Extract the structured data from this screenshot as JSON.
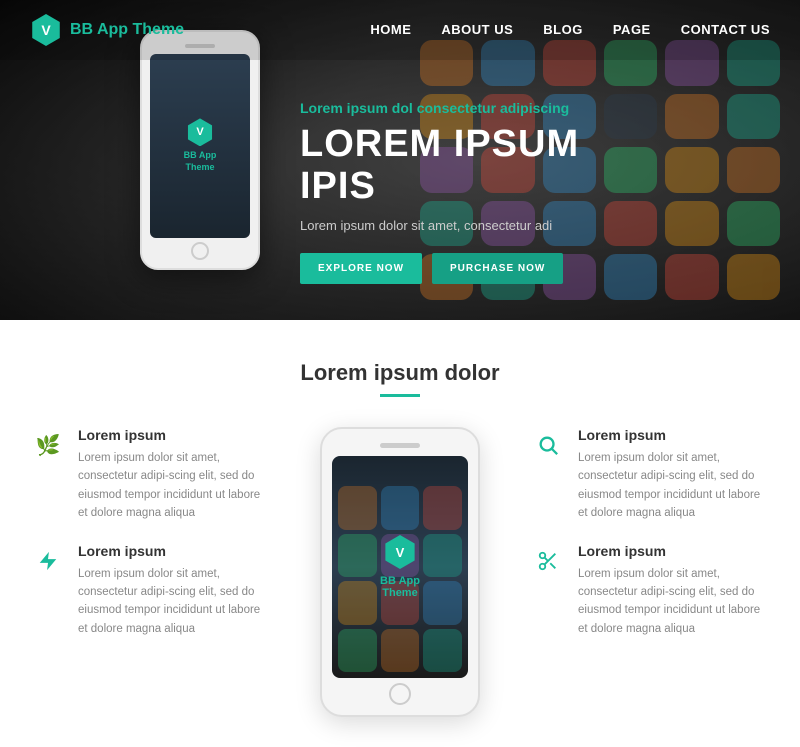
{
  "brand": {
    "logo_letter": "V",
    "name_part1": "BB App",
    "name_part2": " Theme"
  },
  "nav": {
    "links": [
      {
        "label": "HOME",
        "id": "home"
      },
      {
        "label": "ABOUT US",
        "id": "about"
      },
      {
        "label": "BLOG",
        "id": "blog"
      },
      {
        "label": "PAGE",
        "id": "page"
      },
      {
        "label": "CONTACT US",
        "id": "contact"
      }
    ]
  },
  "hero": {
    "subtitle_plain": "Lorem ipsum dol",
    "subtitle_accent": "consectetur",
    "subtitle_end": " adipiscing",
    "title": "LOREM IPSUM IPIS",
    "description": "Lorem ipsum dolor sit amet, consectetur adi",
    "btn_explore": "EXPLORE NOW",
    "btn_purchase": "PURCHASE NOW",
    "phone_letter": "V",
    "phone_app_name": "BB App",
    "phone_theme": "Theme"
  },
  "features_section": {
    "section_title": "Lorem ipsum dolor",
    "left_features": [
      {
        "icon": "🌿",
        "title": "Lorem ipsum",
        "text": "Lorem ipsum dolor sit amet, consectetur adipi-scing elit, sed do eiusmod tempor incididunt ut labore et dolore magna aliqua"
      },
      {
        "icon": "⚡",
        "title": "Lorem ipsum",
        "text": "Lorem ipsum dolor sit amet, consectetur adipi-scing elit, sed do eiusmod tempor incididunt ut labore et dolore magna aliqua"
      }
    ],
    "right_features": [
      {
        "icon": "🔍",
        "title": "Lorem ipsum",
        "text": "Lorem ipsum dolor sit amet, consectetur adipi-scing elit, sed do eiusmod tempor incididunt ut labore et dolore magna aliqua"
      },
      {
        "icon": "✂️",
        "title": "Lorem ipsum",
        "text": "Lorem ipsum dolor sit amet, consectetur adipi-scing elit, sed do eiusmod tempor incididunt ut labore et dolore magna aliqua"
      }
    ],
    "center_phone_letter": "V",
    "center_phone_name": "BB App",
    "center_phone_theme": "Theme"
  }
}
